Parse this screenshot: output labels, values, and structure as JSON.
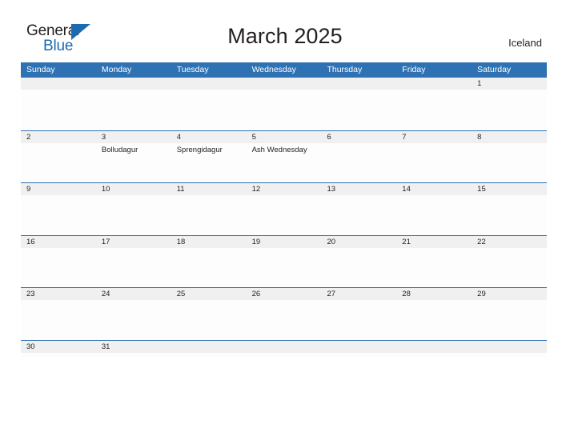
{
  "brand": {
    "name_part1": "General",
    "name_part2": "Blue",
    "flag_icon": "triangle-flag-icon",
    "accent_color": "#1c6ab0"
  },
  "header": {
    "title": "March 2025",
    "region": "Iceland"
  },
  "theme": {
    "header_blue": "#2e72b3",
    "row_divider_blue": "#2e72b3",
    "day_number_strip": "#f0f0f0",
    "cell_background": "#fdfdfd",
    "text_color": "#231f20"
  },
  "calendar": {
    "weekdays": [
      "Sunday",
      "Monday",
      "Tuesday",
      "Wednesday",
      "Thursday",
      "Friday",
      "Saturday"
    ],
    "weeks": [
      {
        "days": [
          {
            "num": "",
            "events": []
          },
          {
            "num": "",
            "events": []
          },
          {
            "num": "",
            "events": []
          },
          {
            "num": "",
            "events": []
          },
          {
            "num": "",
            "events": []
          },
          {
            "num": "",
            "events": []
          },
          {
            "num": "1",
            "events": []
          }
        ]
      },
      {
        "days": [
          {
            "num": "2",
            "events": []
          },
          {
            "num": "3",
            "events": [
              "Bolludagur"
            ]
          },
          {
            "num": "4",
            "events": [
              "Sprengidagur"
            ]
          },
          {
            "num": "5",
            "events": [
              "Ash Wednesday"
            ]
          },
          {
            "num": "6",
            "events": []
          },
          {
            "num": "7",
            "events": []
          },
          {
            "num": "8",
            "events": []
          }
        ]
      },
      {
        "days": [
          {
            "num": "9",
            "events": []
          },
          {
            "num": "10",
            "events": []
          },
          {
            "num": "11",
            "events": []
          },
          {
            "num": "12",
            "events": []
          },
          {
            "num": "13",
            "events": []
          },
          {
            "num": "14",
            "events": []
          },
          {
            "num": "15",
            "events": []
          }
        ]
      },
      {
        "days": [
          {
            "num": "16",
            "events": []
          },
          {
            "num": "17",
            "events": []
          },
          {
            "num": "18",
            "events": []
          },
          {
            "num": "19",
            "events": []
          },
          {
            "num": "20",
            "events": []
          },
          {
            "num": "21",
            "events": []
          },
          {
            "num": "22",
            "events": []
          }
        ]
      },
      {
        "days": [
          {
            "num": "23",
            "events": []
          },
          {
            "num": "24",
            "events": []
          },
          {
            "num": "25",
            "events": []
          },
          {
            "num": "26",
            "events": []
          },
          {
            "num": "27",
            "events": []
          },
          {
            "num": "28",
            "events": []
          },
          {
            "num": "29",
            "events": []
          }
        ]
      },
      {
        "days": [
          {
            "num": "30",
            "events": []
          },
          {
            "num": "31",
            "events": []
          },
          {
            "num": "",
            "events": []
          },
          {
            "num": "",
            "events": []
          },
          {
            "num": "",
            "events": []
          },
          {
            "num": "",
            "events": []
          },
          {
            "num": "",
            "events": []
          }
        ]
      }
    ]
  }
}
